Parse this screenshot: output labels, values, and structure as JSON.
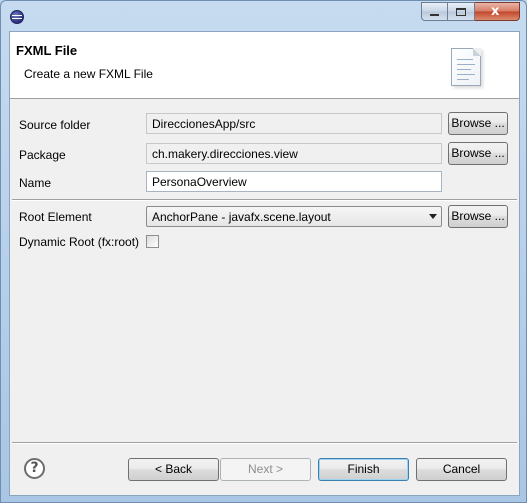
{
  "window": {
    "title": "",
    "caption": {
      "minimize": "",
      "maximize": "",
      "close": "x"
    }
  },
  "banner": {
    "title": "FXML File",
    "description": "Create a new FXML File",
    "icon": "file-icon"
  },
  "form": {
    "source_folder": {
      "label": "Source folder",
      "value": "DireccionesApp/src",
      "browse": "Browse ..."
    },
    "package": {
      "label": "Package",
      "value": "ch.makery.direcciones.view",
      "browse": "Browse ..."
    },
    "name": {
      "label": "Name",
      "value": "PersonaOverview"
    },
    "root_element": {
      "label": "Root Element",
      "value": "AnchorPane - javafx.scene.layout",
      "browse": "Browse ..."
    },
    "dynamic_root": {
      "label": "Dynamic Root (fx:root)",
      "checked": false
    }
  },
  "footer": {
    "help": "?",
    "back": "< Back",
    "next": "Next >",
    "finish": "Finish",
    "cancel": "Cancel"
  },
  "colors": {
    "window_frame": "#a9c6e4",
    "client_bg": "#f0f0f0",
    "default_button_border": "#3c7fb1",
    "disabled_text": "#8d8d8d"
  }
}
